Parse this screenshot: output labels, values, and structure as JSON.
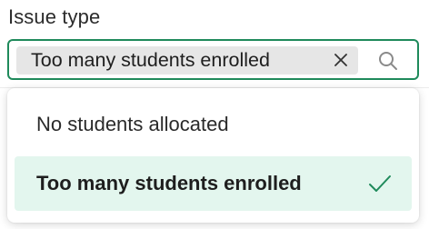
{
  "field": {
    "label": "Issue type",
    "selected_chip": "Too many students enrolled",
    "remove_icon": "close-icon",
    "search_icon": "search-icon"
  },
  "dropdown": {
    "options": [
      {
        "label": "No students allocated",
        "selected": false
      },
      {
        "label": "Too many students enrolled",
        "selected": true,
        "icon": "check-icon"
      }
    ]
  },
  "colors": {
    "accent_border": "#1f8a5b",
    "selected_option_bg": "#e3f6ee",
    "chip_bg": "#e6e6e6",
    "check": "#1f8a5b"
  }
}
